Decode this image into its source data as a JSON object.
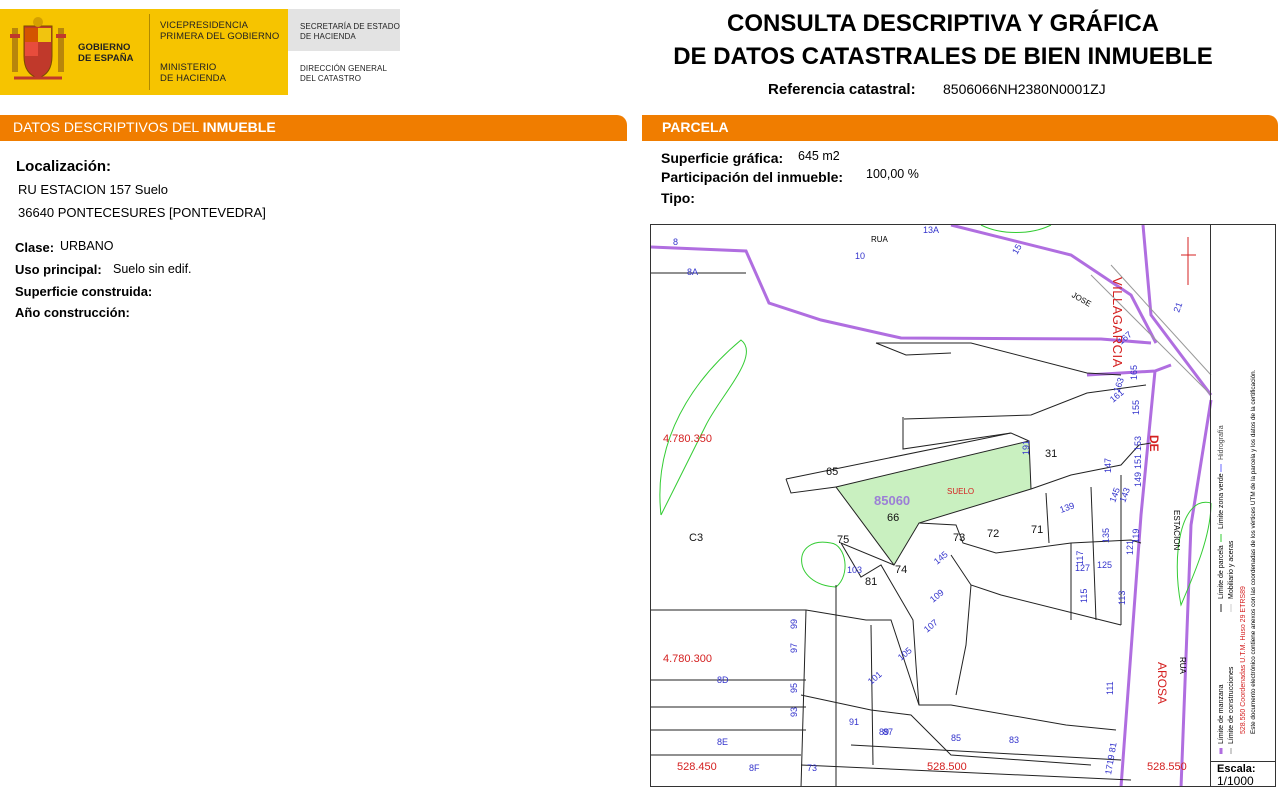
{
  "header": {
    "gov_name_1": "GOBIERNO",
    "gov_name_2": "DE ESPAÑA",
    "vice_1": "VICEPRESIDENCIA",
    "vice_2": "PRIMERA DEL GOBIERNO",
    "min_1": "MINISTERIO",
    "min_2": "DE HACIENDA",
    "sec_1": "SECRETARÍA DE ESTADO",
    "sec_2": "DE HACIENDA",
    "dir_1": "DIRECCIÓN GENERAL",
    "dir_2": "DEL CATASTRO",
    "title_1": "CONSULTA DESCRIPTIVA Y GRÁFICA",
    "title_2": "DE DATOS CATASTRALES DE BIEN INMUEBLE",
    "ref_label": "Referencia catastral:",
    "ref_value": "8506066NH2380N0001ZJ"
  },
  "left": {
    "section_title_a": "DATOS DESCRIPTIVOS DEL ",
    "section_title_b": "INMUEBLE",
    "localizacion_label": "Localización:",
    "address_1": "RU ESTACION 157 Suelo",
    "address_2": "36640 PONTECESURES [PONTEVEDRA]",
    "clase_label": "Clase:",
    "clase_value": "URBANO",
    "uso_label": "Uso principal:",
    "uso_value": "Suelo sin edif.",
    "sup_label": "Superficie construida:",
    "anio_label": "Año construcción:"
  },
  "right": {
    "section_title": "PARCELA",
    "sup_label": "Superficie gráfica:",
    "sup_value": "645 m2",
    "part_label": "Participación del inmueble:",
    "part_value": "100,00 %",
    "tipo_label": "Tipo:"
  },
  "map": {
    "parcel_ref": "85060",
    "parcel_use": "SUELO",
    "street_villagarcia": "VILLAGARCIA",
    "street_de": "DE",
    "street_arosa": "AROSA",
    "street_rua_top": "RUA",
    "street_rua_right": "RUA",
    "street_jose": "JOSE",
    "street_estacion": "ESTACION",
    "coord_y1": "4.780.350",
    "coord_y2": "4.780.300",
    "coord_x1": "528.450",
    "coord_x2": "528.500",
    "coord_x3": "528.550",
    "labels": [
      {
        "t": "8",
        "c": "blue"
      },
      {
        "t": "8A",
        "c": "blue"
      },
      {
        "t": "10",
        "c": "blue"
      },
      {
        "t": "13A",
        "c": "blue"
      },
      {
        "t": "15",
        "c": "blue"
      },
      {
        "t": "21",
        "c": "blue"
      },
      {
        "t": "167",
        "c": "blue"
      },
      {
        "t": "165",
        "c": "blue"
      },
      {
        "t": "163",
        "c": "blue"
      },
      {
        "t": "161",
        "c": "blue"
      },
      {
        "t": "155",
        "c": "blue"
      },
      {
        "t": "153",
        "c": "blue"
      },
      {
        "t": "151",
        "c": "blue"
      },
      {
        "t": "149",
        "c": "blue"
      },
      {
        "t": "191",
        "c": "blue"
      },
      {
        "t": "31",
        "c": "black"
      },
      {
        "t": "65",
        "c": "black"
      },
      {
        "t": "66",
        "c": "black"
      },
      {
        "t": "C3",
        "c": "black"
      },
      {
        "t": "147",
        "c": "blue"
      },
      {
        "t": "145",
        "c": "blue"
      },
      {
        "t": "143",
        "c": "blue"
      },
      {
        "t": "139",
        "c": "blue"
      },
      {
        "t": "135",
        "c": "blue"
      },
      {
        "t": "71",
        "c": "black"
      },
      {
        "t": "72",
        "c": "black"
      },
      {
        "t": "73",
        "c": "black"
      },
      {
        "t": "74",
        "c": "black"
      },
      {
        "t": "75",
        "c": "black"
      },
      {
        "t": "81",
        "c": "black"
      },
      {
        "t": "103",
        "c": "blue"
      },
      {
        "t": "109",
        "c": "blue"
      },
      {
        "t": "107",
        "c": "blue"
      },
      {
        "t": "105",
        "c": "blue"
      },
      {
        "t": "101",
        "c": "blue"
      },
      {
        "t": "117",
        "c": "blue"
      },
      {
        "t": "125",
        "c": "blue"
      },
      {
        "t": "127",
        "c": "blue"
      },
      {
        "t": "115",
        "c": "blue"
      },
      {
        "t": "113",
        "c": "blue"
      },
      {
        "t": "111",
        "c": "blue"
      },
      {
        "t": "121",
        "c": "blue"
      },
      {
        "t": "119",
        "c": "blue"
      },
      {
        "t": "99",
        "c": "blue"
      },
      {
        "t": "97",
        "c": "blue"
      },
      {
        "t": "95",
        "c": "blue"
      },
      {
        "t": "93",
        "c": "blue"
      },
      {
        "t": "91",
        "c": "blue"
      },
      {
        "t": "89",
        "c": "blue"
      },
      {
        "t": "87",
        "c": "blue"
      },
      {
        "t": "85",
        "c": "blue"
      },
      {
        "t": "83",
        "c": "blue"
      },
      {
        "t": "8D",
        "c": "blue"
      },
      {
        "t": "8E",
        "c": "blue"
      },
      {
        "t": "8F",
        "c": "blue"
      },
      {
        "t": "73",
        "c": "blue"
      },
      {
        "t": "1719 81",
        "c": "blue"
      },
      {
        "t": "145",
        "c": "blue"
      }
    ]
  },
  "legend": {
    "items": [
      "Límite de manzana",
      "Límite de parcela",
      "Límite de construcciones",
      "Mobiliario y aceras",
      "Límite zona verde",
      "Hidrografía"
    ],
    "coords_note": "528.550 Coordenadas U.T.M. Huso 29 ETRS89",
    "doc_note": "Este documento electrónico contiene anexos con las coordenadas de los vértices UTM de la parcela y los datos de la certificación.",
    "scale_label": "Escala:",
    "scale_value": "1/1000"
  },
  "colors": {
    "orange": "#f07d00",
    "gold": "#f6c400",
    "parcel_fill": "#c9f0c0",
    "street_boundary": "#b06ee0",
    "green_zone": "#33cc33",
    "red_coord": "#d42020"
  }
}
